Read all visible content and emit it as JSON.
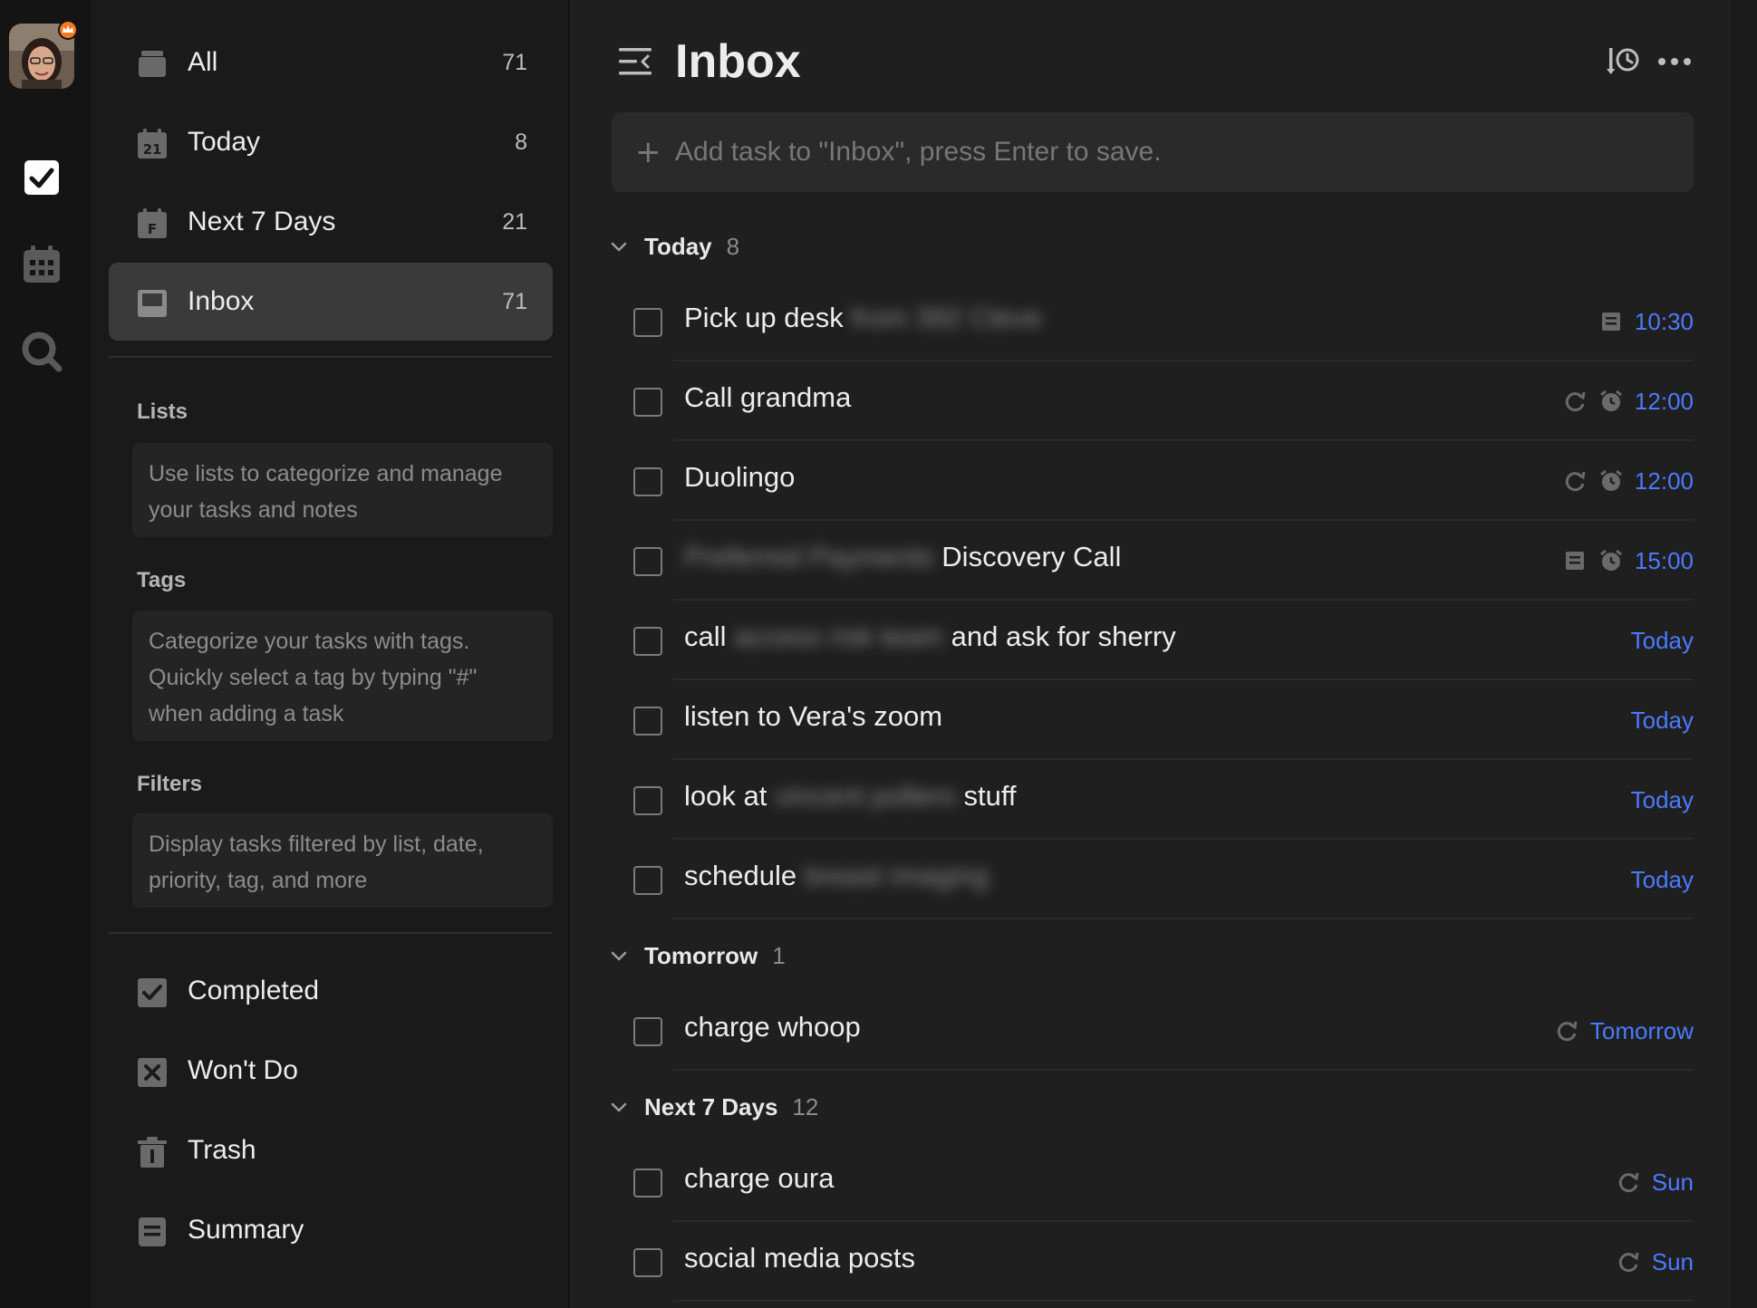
{
  "colors": {
    "accent": "#4a7bff",
    "crown": "#f47a22",
    "active_bg": "#3a3a3a"
  },
  "rail": {
    "items": [
      {
        "name": "tasks",
        "icon": "checkbox-icon"
      },
      {
        "name": "calendar",
        "icon": "calendar-icon"
      },
      {
        "name": "search",
        "icon": "search-icon"
      }
    ]
  },
  "sidebar": {
    "smart_lists": [
      {
        "label": "All",
        "count": "71",
        "icon": "all-tray-icon"
      },
      {
        "label": "Today",
        "count": "8",
        "icon": "calendar-21-icon"
      },
      {
        "label": "Next 7 Days",
        "count": "21",
        "icon": "calendar-f-icon"
      },
      {
        "label": "Inbox",
        "count": "71",
        "icon": "inbox-icon",
        "active": true
      }
    ],
    "lists": {
      "title": "Lists",
      "hint": "Use lists to categorize and manage your tasks and notes"
    },
    "tags": {
      "title": "Tags",
      "hint": "Categorize your tasks with tags. Quickly select a tag by typing \"#\" when adding a task"
    },
    "filters": {
      "title": "Filters",
      "hint": "Display tasks filtered by list, date, priority, tag, and more"
    },
    "bottom": [
      {
        "label": "Completed",
        "icon": "completed-icon"
      },
      {
        "label": "Won't Do",
        "icon": "wont-do-icon"
      },
      {
        "label": "Trash",
        "icon": "trash-icon"
      },
      {
        "label": "Summary",
        "icon": "summary-icon"
      }
    ]
  },
  "main": {
    "title": "Inbox",
    "add_task_placeholder": "Add task to \"Inbox\", press Enter to save.",
    "groups": [
      {
        "title": "Today",
        "count": "8",
        "tasks": [
          {
            "parts": [
              "Pick up desk"
            ],
            "blurred": [
              "from 392 Cleve"
            ],
            "meta_icons": [
              "note-icon"
            ],
            "date": "10:30"
          },
          {
            "parts": [
              "Call grandma"
            ],
            "meta_icons": [
              "repeat-icon",
              "alarm-icon"
            ],
            "date": "12:00"
          },
          {
            "parts": [
              "Duolingo"
            ],
            "meta_icons": [
              "repeat-icon",
              "alarm-icon"
            ],
            "date": "12:00"
          },
          {
            "parts": [
              "Discovery Call"
            ],
            "blurred_prefix": "Preferred Payments",
            "meta_icons": [
              "note-icon",
              "alarm-icon"
            ],
            "date": "15:00"
          },
          {
            "parts": [
              "call",
              "and ask for sherry"
            ],
            "blurred_mid": "access risk team",
            "date": "Today"
          },
          {
            "parts": [
              "listen to Vera's zoom"
            ],
            "date": "Today"
          },
          {
            "parts": [
              "look at",
              "stuff"
            ],
            "blurred_mid": "vincent pollero",
            "date": "Today"
          },
          {
            "parts": [
              "schedule"
            ],
            "blurred": [
              "breast imaging"
            ],
            "date": "Today"
          }
        ]
      },
      {
        "title": "Tomorrow",
        "count": "1",
        "tasks": [
          {
            "parts": [
              "charge whoop"
            ],
            "meta_icons": [
              "repeat-icon"
            ],
            "date": "Tomorrow"
          }
        ]
      },
      {
        "title": "Next 7 Days",
        "count": "12",
        "tasks": [
          {
            "parts": [
              "charge oura"
            ],
            "meta_icons": [
              "repeat-icon"
            ],
            "date": "Sun"
          },
          {
            "parts": [
              "social media posts"
            ],
            "meta_icons": [
              "repeat-icon"
            ],
            "date": "Sun"
          }
        ]
      }
    ]
  }
}
